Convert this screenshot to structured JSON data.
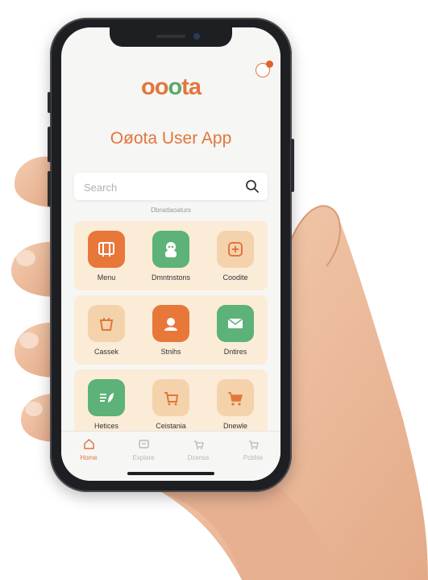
{
  "app": {
    "logo_text_a": "oo",
    "logo_text_b": "ta",
    "logo_mid": "o",
    "title": "Oøota User App",
    "search_placeholder": "Search",
    "section_label": "Dbnatlaoaturs"
  },
  "colors": {
    "accent": "#e2763c",
    "orange_tile": "#e8773a",
    "green_tile": "#5cb278",
    "peach_tile": "#f4d3ac",
    "row_bg": "#fbecd8"
  },
  "tiles": [
    {
      "label": "Menu",
      "icon": "menu-icon",
      "style": "orange"
    },
    {
      "label": "Dmntnstons",
      "icon": "robot-icon",
      "style": "green"
    },
    {
      "label": "Coodite",
      "icon": "stamp-icon",
      "style": "peach"
    },
    {
      "label": "Cassek",
      "icon": "basket-icon",
      "style": "peach"
    },
    {
      "label": "Stnihs",
      "icon": "support-icon",
      "style": "orange"
    },
    {
      "label": "Dntires",
      "icon": "ticket-icon",
      "style": "green"
    },
    {
      "label": "Hetices",
      "icon": "leaf-list-icon",
      "style": "green"
    },
    {
      "label": "Ceistania",
      "icon": "cart-box-icon",
      "style": "peach"
    },
    {
      "label": "Dnewle",
      "icon": "cart-icon",
      "style": "peach"
    }
  ],
  "nav": [
    {
      "label": "Home",
      "icon": "home-icon",
      "active": true
    },
    {
      "label": "Explare",
      "icon": "explore-icon",
      "active": false
    },
    {
      "label": "Dcenss",
      "icon": "basket-nav-icon",
      "active": false
    },
    {
      "label": "Pcbhie",
      "icon": "cart-nav-icon",
      "active": false
    }
  ]
}
